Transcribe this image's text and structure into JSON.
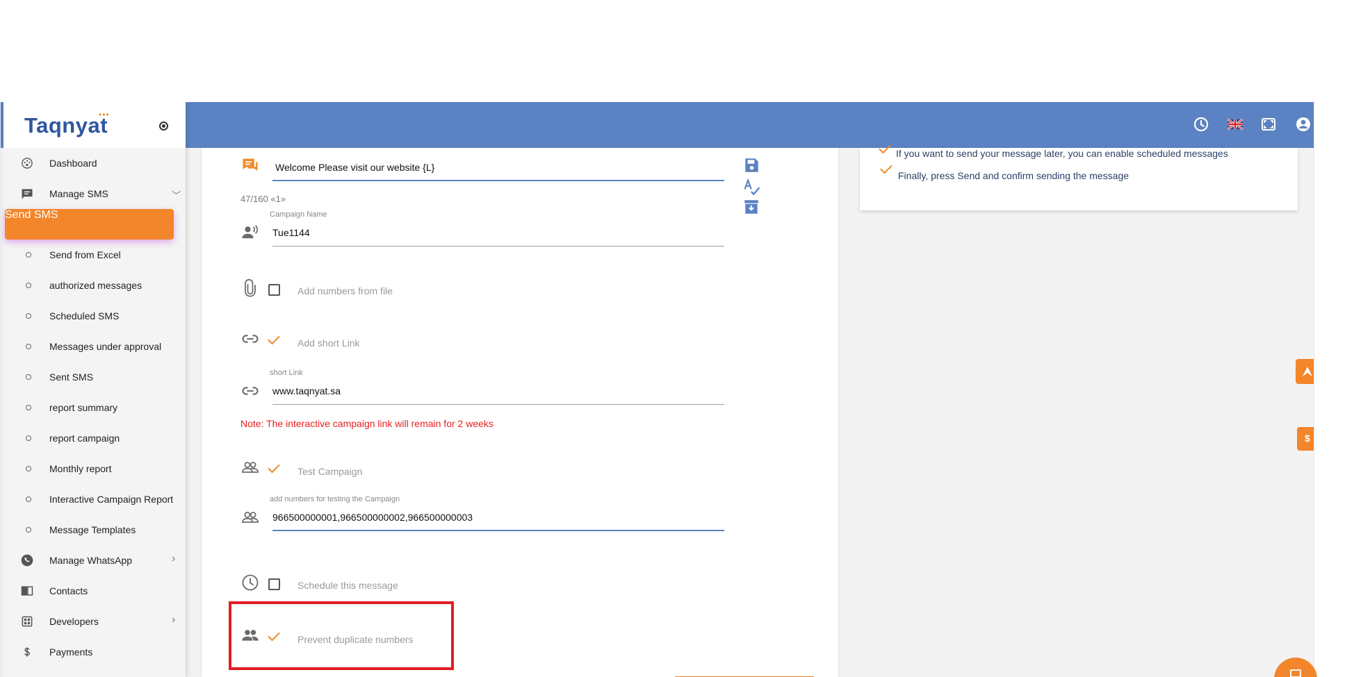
{
  "brand": {
    "name": "Taqnyat",
    "dots": "•••"
  },
  "sidebar": {
    "items": [
      {
        "label": "Dashboard",
        "icon": "dashboard-icon"
      },
      {
        "label": "Manage SMS",
        "icon": "sms-icon",
        "chevron": "﹀"
      },
      {
        "label": "Send SMS",
        "active": true
      },
      {
        "label": "Send from Excel"
      },
      {
        "label": "authorized messages"
      },
      {
        "label": "Scheduled SMS"
      },
      {
        "label": "Messages under approval"
      },
      {
        "label": "Sent SMS"
      },
      {
        "label": "report summary"
      },
      {
        "label": "report campaign"
      },
      {
        "label": "Monthly report"
      },
      {
        "label": "Interactive Campaign Report"
      },
      {
        "label": "Message Templates"
      },
      {
        "label": "Manage WhatsApp",
        "icon": "whatsapp-icon",
        "chevron": "›"
      },
      {
        "label": "Contacts",
        "icon": "contacts-icon"
      },
      {
        "label": "Developers",
        "icon": "developers-icon",
        "chevron": "›"
      },
      {
        "label": "Payments",
        "icon": "dollar-icon"
      }
    ]
  },
  "topbar": {
    "icons": [
      "history-icon",
      "uk-flag-icon",
      "fullscreen-icon",
      "account-icon"
    ]
  },
  "form": {
    "message_value": "Welcome Please visit our website {L}",
    "counter": "47/160 «1»",
    "campaign_name_label": "Campaign Name",
    "campaign_name_value": "Tue1144",
    "add_numbers_from_file": "Add numbers from file",
    "add_short_link": "Add short Link",
    "short_link_label": "short Link",
    "short_link_value": "www.taqnyat.sa",
    "note": "Note: The interactive campaign link will remain for 2 weeks",
    "test_campaign": "Test Campaign",
    "test_numbers_label": "add numbers for testing the Campaign",
    "test_numbers_value": "966500000001,966500000002,966500000003",
    "schedule_message": "Schedule this message",
    "prevent_duplicates": "Prevent duplicate numbers"
  },
  "instructions": {
    "line1": "If you want to send your message later, you can enable scheduled messages",
    "line2": "Finally, press Send and confirm sending the message"
  },
  "floating": {
    "dollar": "$"
  },
  "colors": {
    "accent": "#f3852a",
    "primary": "#5b82c2",
    "note": "#e8201f",
    "highlight": "#e21e24"
  }
}
